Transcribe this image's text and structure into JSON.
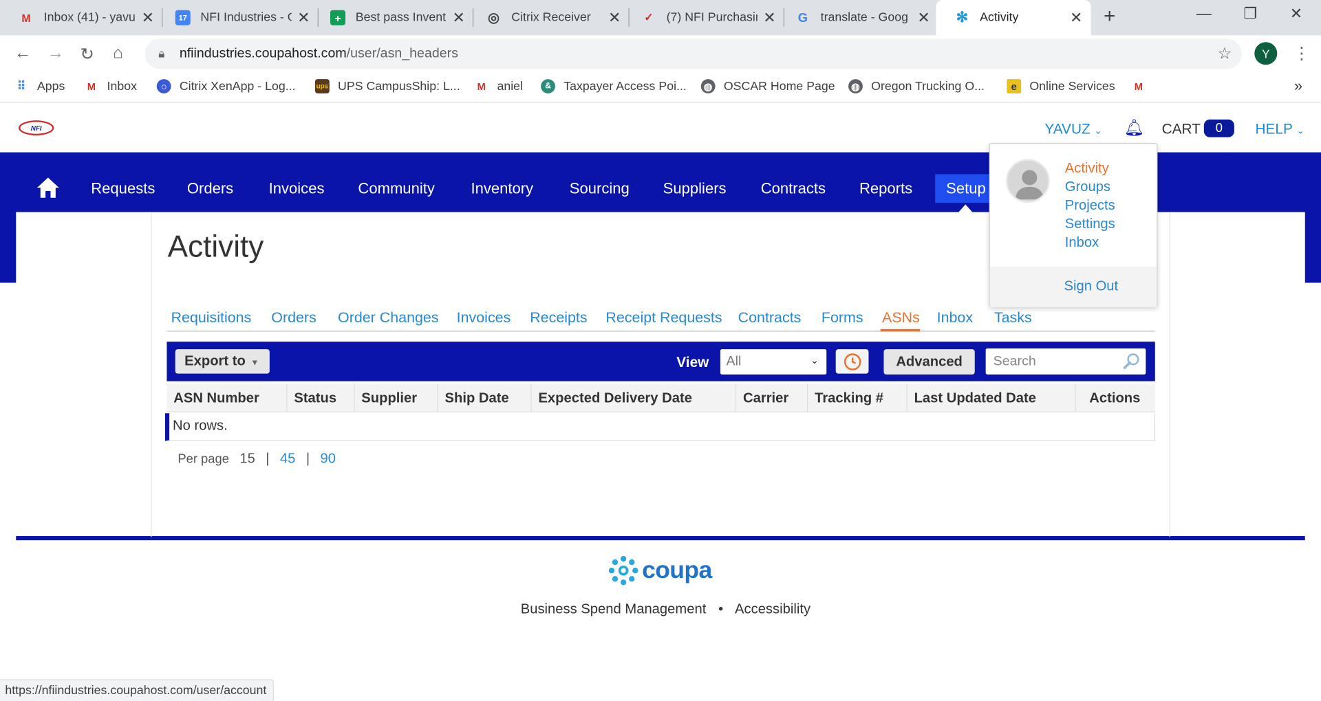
{
  "browser": {
    "tabs": [
      {
        "title": "Inbox (41) - yavu",
        "icon": "gmail-icon"
      },
      {
        "title": "NFI Industries - G",
        "icon": "calendar-icon"
      },
      {
        "title": "Best pass Invent",
        "icon": "sheets-icon"
      },
      {
        "title": "Citrix Receiver",
        "icon": "citrix-icon"
      },
      {
        "title": "(7) NFI Purchasin",
        "icon": "nfi-icon"
      },
      {
        "title": "translate - Goog",
        "icon": "google-icon"
      },
      {
        "title": "Activity",
        "icon": "coupa-icon"
      }
    ],
    "url_host": "nfiindustries.coupahost.com",
    "url_path": "/user/asn_headers",
    "profile_initial": "Y",
    "bookmarks": [
      {
        "label": "Apps"
      },
      {
        "label": "Inbox"
      },
      {
        "label": "Citrix XenApp - Log..."
      },
      {
        "label": "UPS CampusShip: L..."
      },
      {
        "label": "aniel"
      },
      {
        "label": "Taxpayer Access Poi..."
      },
      {
        "label": "OSCAR Home Page"
      },
      {
        "label": "Oregon Trucking O..."
      },
      {
        "label": "Online Services"
      }
    ],
    "bookmarks_more": "»",
    "status_url": "https://nfiindustries.coupahost.com/user/account"
  },
  "header": {
    "logo_text": "NFI",
    "user": "YAVUZ",
    "cart_label": "CART",
    "cart_count": "0",
    "help_label": "HELP"
  },
  "nav": {
    "items": [
      "Requests",
      "Orders",
      "Invoices",
      "Community",
      "Inventory",
      "Sourcing",
      "Suppliers",
      "Contracts",
      "Reports"
    ],
    "active": "Setup"
  },
  "page": {
    "title": "Activity",
    "subtabs": [
      "Requisitions",
      "Orders",
      "Order Changes",
      "Invoices",
      "Receipts",
      "Receipt Requests",
      "Contracts",
      "Forms",
      "ASNs",
      "Inbox",
      "Tasks"
    ],
    "active_subtab": "ASNs"
  },
  "table": {
    "export_label": "Export to",
    "view_label": "View",
    "view_value": "All",
    "advanced_label": "Advanced",
    "search_placeholder": "Search",
    "columns": [
      "ASN Number",
      "Status",
      "Supplier",
      "Ship Date",
      "Expected Delivery Date",
      "Carrier",
      "Tracking #",
      "Last Updated Date",
      "Actions"
    ],
    "empty_text": "No rows.",
    "per_page_label": "Per page",
    "per_page_current": "15",
    "per_page_options": [
      "45",
      "90"
    ]
  },
  "user_menu": {
    "items": [
      "Activity",
      "Groups",
      "Projects",
      "Settings",
      "Inbox"
    ],
    "active": "Activity",
    "sign_out": "Sign Out"
  },
  "footer": {
    "brand": "coupa",
    "links": [
      "Business Spend Management",
      "Accessibility"
    ],
    "separator": "•"
  },
  "colors": {
    "nav_blue": "#0a14a8",
    "link_blue": "#2a88d0",
    "active_orange": "#e9712a",
    "setup_blue": "#1f4df0"
  }
}
